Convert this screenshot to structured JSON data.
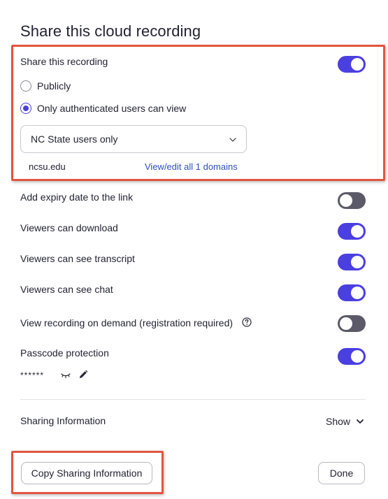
{
  "dialog": {
    "title": "Share this cloud recording"
  },
  "share": {
    "label": "Share this recording",
    "enabled": true,
    "options": [
      {
        "label": "Publicly",
        "checked": false
      },
      {
        "label": "Only authenticated users can view",
        "checked": true
      }
    ],
    "audience_select": {
      "value": "NC State users only"
    },
    "domain": "ncsu.edu",
    "domains_link": "View/edit all 1 domains"
  },
  "settings": [
    {
      "label": "Add expiry date to the link",
      "enabled": false
    },
    {
      "label": "Viewers can download",
      "enabled": true
    },
    {
      "label": "Viewers can see transcript",
      "enabled": true
    },
    {
      "label": "Viewers can see chat",
      "enabled": true
    },
    {
      "label": "View recording on demand (registration required)",
      "enabled": false
    },
    {
      "label": "Passcode protection",
      "enabled": true
    }
  ],
  "passcode": {
    "masked_value": "******"
  },
  "sharing_info": {
    "label": "Sharing Information",
    "show_label": "Show"
  },
  "buttons": {
    "copy_label": "Copy Sharing Information",
    "done_label": "Done"
  },
  "colors": {
    "accent": "#4a3fe0",
    "toggle_off": "#5a5a68",
    "link": "#2d4fc7",
    "highlight": "#e2553f"
  },
  "icons": [
    "chevron-down-icon",
    "help-circle-icon",
    "eye-closed-icon",
    "pencil-icon"
  ]
}
